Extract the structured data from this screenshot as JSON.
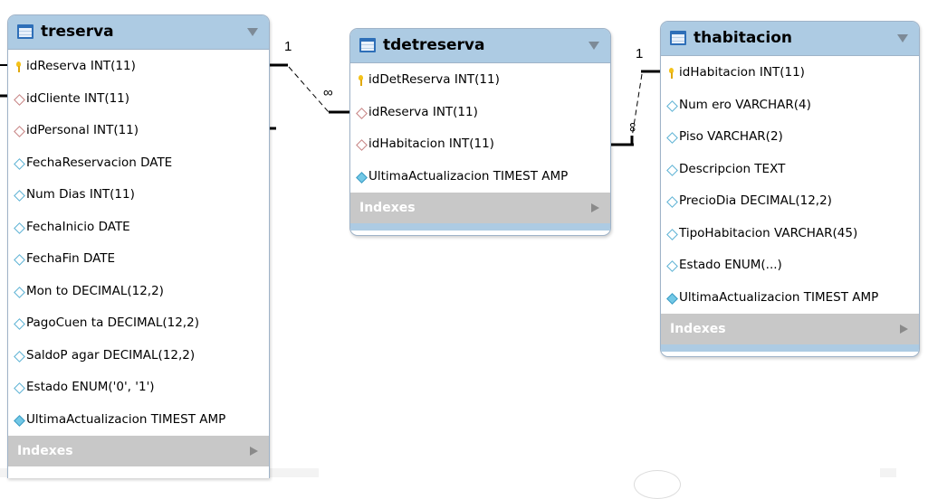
{
  "tables": {
    "treserva": {
      "name": "treserva",
      "columns": [
        {
          "text": "idReserva INT(11)",
          "marker": "primary-key"
        },
        {
          "text": "idCliente INT(11)",
          "marker": "foreign-key"
        },
        {
          "text": "idPersonal INT(11)",
          "marker": "foreign-key"
        },
        {
          "text": "FechaReservacion DATE",
          "marker": "attribute"
        },
        {
          "text": "Num Dias INT(11)",
          "marker": "attribute"
        },
        {
          "text": "FechaInicio DATE",
          "marker": "attribute"
        },
        {
          "text": "FechaFin DATE",
          "marker": "attribute"
        },
        {
          "text": "Mon to DECIMAL(12,2)",
          "marker": "attribute"
        },
        {
          "text": "PagoCuen ta DECIMAL(12,2)",
          "marker": "attribute"
        },
        {
          "text": "SaldoP agar DECIMAL(12,2)",
          "marker": "attribute"
        },
        {
          "text": "Estado ENUM('0', '1')",
          "marker": "attribute"
        },
        {
          "text": "UltimaActualizacion TIMEST AMP",
          "marker": "attribute-filled"
        }
      ],
      "indexes_label": "Indexes"
    },
    "tdetreserva": {
      "name": "tdetreserva",
      "columns": [
        {
          "text": "idDetReserva INT(11)",
          "marker": "primary-key"
        },
        {
          "text": "idReserva INT(11)",
          "marker": "foreign-key"
        },
        {
          "text": "idHabitacion INT(11)",
          "marker": "foreign-key"
        },
        {
          "text": "UltimaActualizacion TIMEST AMP",
          "marker": "attribute-filled"
        }
      ],
      "indexes_label": "Indexes"
    },
    "thabitacion": {
      "name": "thabitacion",
      "columns": [
        {
          "text": "idHabitacion INT(11)",
          "marker": "primary-key"
        },
        {
          "text": "Num ero VARCHAR(4)",
          "marker": "attribute"
        },
        {
          "text": "Piso VARCHAR(2)",
          "marker": "attribute"
        },
        {
          "text": "Descripcion TEXT",
          "marker": "attribute"
        },
        {
          "text": "PrecioDia DECIMAL(12,2)",
          "marker": "attribute"
        },
        {
          "text": "TipoHabitacion VARCHAR(45)",
          "marker": "attribute"
        },
        {
          "text": "Estado ENUM(...)",
          "marker": "attribute"
        },
        {
          "text": "UltimaActualizacion TIMEST AMP",
          "marker": "attribute-filled"
        }
      ],
      "indexes_label": "Indexes"
    }
  },
  "relationships": [
    {
      "from": "treserva",
      "to": "tdetreserva",
      "from_cardinality": "1",
      "to_cardinality": "∞"
    },
    {
      "from": "thabitacion",
      "to": "tdetreserva",
      "from_cardinality": "1",
      "to_cardinality": "∞"
    }
  ],
  "colors": {
    "header": "#adcbe3",
    "border": "#9fb3c8",
    "indexes_bar": "#c8c8c8",
    "primary_key": "#f4c21a",
    "foreign_key": "#c68080",
    "attribute": "#5ab1d4"
  }
}
